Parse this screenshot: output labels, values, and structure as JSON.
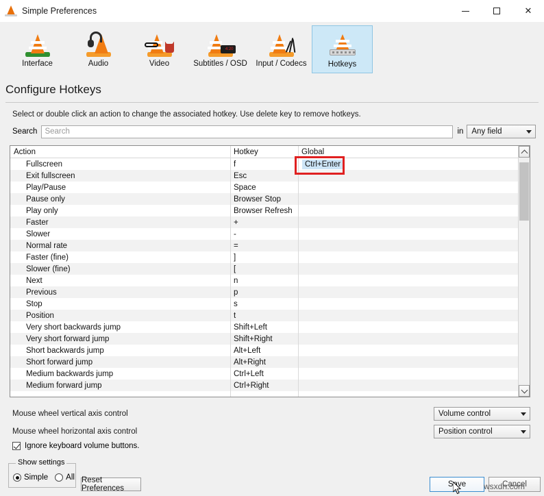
{
  "window": {
    "title": "Simple Preferences",
    "icon": "vlc-cone-icon",
    "controls": {
      "minimize": "—",
      "maximize": "□",
      "close": "✕"
    }
  },
  "toolbar": {
    "items": [
      {
        "label": "Interface",
        "icon": "interface-cone-icon",
        "selected": false
      },
      {
        "label": "Audio",
        "icon": "audio-headphones-icon",
        "selected": false
      },
      {
        "label": "Video",
        "icon": "video-cone-icon",
        "selected": false
      },
      {
        "label": "Subtitles / OSD",
        "icon": "subtitles-osd-icon",
        "selected": false
      },
      {
        "label": "Input / Codecs",
        "icon": "input-codecs-icon",
        "selected": false
      },
      {
        "label": "Hotkeys",
        "icon": "hotkeys-keyboard-icon",
        "selected": true
      }
    ]
  },
  "page": {
    "title": "Configure Hotkeys",
    "hint": "Select or double click an action to change the associated hotkey. Use delete key to remove hotkeys."
  },
  "search": {
    "label": "Search",
    "placeholder": "Search",
    "value": "",
    "in_label": "in",
    "scope_value": "Any field"
  },
  "table": {
    "columns": [
      "Action",
      "Hotkey",
      "Global"
    ],
    "selected_cell": {
      "row": 0,
      "column": "Global",
      "value": "Ctrl+Enter"
    },
    "rows": [
      {
        "action": "Fullscreen",
        "hotkey": "f",
        "global": "Ctrl+Enter"
      },
      {
        "action": "Exit fullscreen",
        "hotkey": "Esc",
        "global": ""
      },
      {
        "action": "Play/Pause",
        "hotkey": "Space",
        "global": ""
      },
      {
        "action": "Pause only",
        "hotkey": "Browser Stop",
        "global": ""
      },
      {
        "action": "Play only",
        "hotkey": "Browser Refresh",
        "global": ""
      },
      {
        "action": "Faster",
        "hotkey": "+",
        "global": ""
      },
      {
        "action": "Slower",
        "hotkey": "-",
        "global": ""
      },
      {
        "action": "Normal rate",
        "hotkey": "=",
        "global": ""
      },
      {
        "action": "Faster (fine)",
        "hotkey": "]",
        "global": ""
      },
      {
        "action": "Slower (fine)",
        "hotkey": "[",
        "global": ""
      },
      {
        "action": "Next",
        "hotkey": "n",
        "global": ""
      },
      {
        "action": "Previous",
        "hotkey": "p",
        "global": ""
      },
      {
        "action": "Stop",
        "hotkey": "s",
        "global": ""
      },
      {
        "action": "Position",
        "hotkey": "t",
        "global": ""
      },
      {
        "action": "Very short backwards jump",
        "hotkey": "Shift+Left",
        "global": ""
      },
      {
        "action": "Very short forward jump",
        "hotkey": "Shift+Right",
        "global": ""
      },
      {
        "action": "Short backwards jump",
        "hotkey": "Alt+Left",
        "global": ""
      },
      {
        "action": "Short forward jump",
        "hotkey": "Alt+Right",
        "global": ""
      },
      {
        "action": "Medium backwards jump",
        "hotkey": "Ctrl+Left",
        "global": ""
      },
      {
        "action": "Medium forward jump",
        "hotkey": "Ctrl+Right",
        "global": ""
      }
    ]
  },
  "mouse_wheel": {
    "vertical_label": "Mouse wheel vertical axis control",
    "vertical_value": "Volume control",
    "horizontal_label": "Mouse wheel horizontal axis control",
    "horizontal_value": "Position control"
  },
  "ignore_volume": {
    "label": "Ignore keyboard volume buttons.",
    "checked": true
  },
  "show_settings": {
    "title": "Show settings",
    "options": [
      "Simple",
      "All"
    ],
    "selected": "Simple"
  },
  "buttons": {
    "reset": "Reset Preferences",
    "save": "Save",
    "cancel": "Cancel"
  },
  "watermark": "wsxdn.com",
  "colors": {
    "accent": "#cde8f7",
    "selection": "#cde5f7",
    "annotation": "#e02020",
    "vlc_orange": "#f07c12",
    "window_bg": "#f0f0f0"
  }
}
